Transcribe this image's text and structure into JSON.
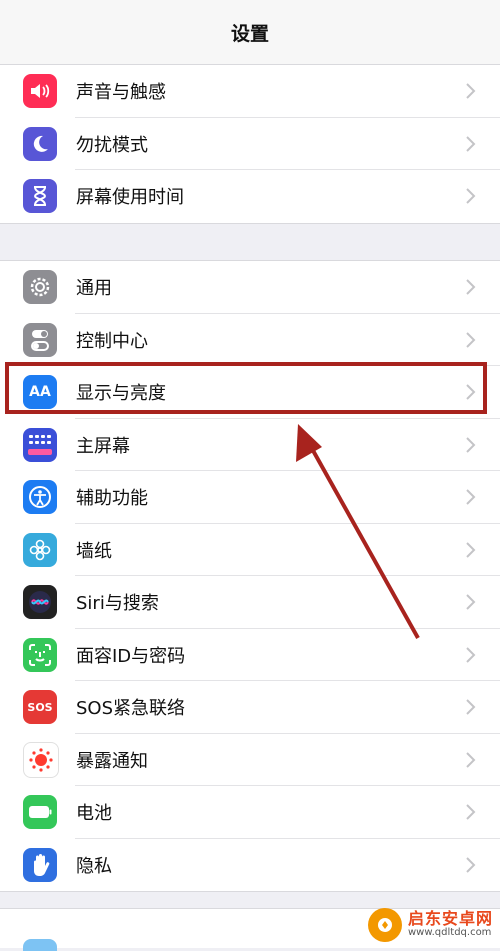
{
  "header": {
    "title": "设置"
  },
  "groups": [
    {
      "items": [
        {
          "label": "声音与触感",
          "icon": "speaker-icon",
          "color": "#ff2d55"
        },
        {
          "label": "勿扰模式",
          "icon": "moon-icon",
          "color": "#5856d6"
        },
        {
          "label": "屏幕使用时间",
          "icon": "hourglass-icon",
          "color": "#5856d6"
        }
      ]
    },
    {
      "items": [
        {
          "label": "通用",
          "icon": "gear-icon",
          "color": "#8e8e93"
        },
        {
          "label": "控制中心",
          "icon": "toggles-icon",
          "color": "#8e8e93"
        },
        {
          "label": "显示与亮度",
          "icon": "text-size-icon",
          "color": "#1d7cf2",
          "icon_text": "AA"
        },
        {
          "label": "主屏幕",
          "icon": "home-grid-icon",
          "color": "#3a4fd8"
        },
        {
          "label": "辅助功能",
          "icon": "accessibility-icon",
          "color": "#1d7cf2"
        },
        {
          "label": "墙纸",
          "icon": "flower-icon",
          "color": "#36aadc"
        },
        {
          "label": "Siri与搜索",
          "icon": "siri-icon",
          "color": "#222"
        },
        {
          "label": "面容ID与密码",
          "icon": "face-id-icon",
          "color": "#34c759"
        },
        {
          "label": "SOS紧急联络",
          "icon": "sos-icon",
          "color": "#e53935",
          "icon_text": "SOS"
        },
        {
          "label": "暴露通知",
          "icon": "exposure-icon",
          "color": "#ffffff"
        },
        {
          "label": "电池",
          "icon": "battery-icon",
          "color": "#34c759"
        },
        {
          "label": "隐私",
          "icon": "hand-icon",
          "color": "#2f6fe0"
        }
      ]
    }
  ],
  "annotation": {
    "highlight_color": "#a8231e"
  },
  "watermark": {
    "name": "启东安卓网",
    "url": "www.qdltdq.com"
  }
}
